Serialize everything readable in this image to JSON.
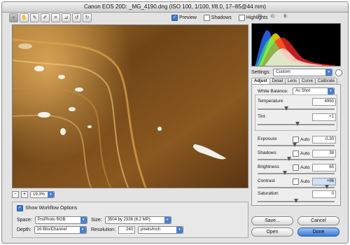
{
  "window": {
    "title": "Canon EOS 20D:  _MG_4190.dng  (ISO 100, 1/100, f/8.0, 17–85@44 mm)"
  },
  "toolbar": {
    "tools": [
      "zoom-tool-icon",
      "hand-tool-icon",
      "white-balance-tool-icon",
      "color-sampler-icon",
      "crop-tool-icon",
      "straighten-tool-icon",
      "rotate-left-icon",
      "rotate-right-icon"
    ]
  },
  "view_options": {
    "preview": {
      "label": "Preview",
      "checked": true
    },
    "shadows": {
      "label": "Shadows",
      "checked": false
    },
    "highlights": {
      "label": "Highlights",
      "checked": false
    }
  },
  "rgb_readout": {
    "r": "R:",
    "g": "G:",
    "b": "B:"
  },
  "zoom": {
    "minus": "-",
    "plus": "+",
    "value": "19.3%"
  },
  "workflow": {
    "show_label": "Show Workflow Options",
    "show_checked": true,
    "space_label": "Space:",
    "space_value": "ProPhoto RGB",
    "size_label": "Size:",
    "size_value": "3504 by 2336  (8.2 MP)",
    "depth_label": "Depth:",
    "depth_value": "16 Bits/Channel",
    "resolution_label": "Resolution:",
    "resolution_value": "240",
    "resolution_unit": "pixels/inch"
  },
  "settings": {
    "label": "Settings:",
    "value": "Custom"
  },
  "tabs": [
    "Adjust",
    "Detail",
    "Lens",
    "Curve",
    "Calibrate"
  ],
  "adjust": {
    "white_balance_label": "White Balance:",
    "white_balance_value": "As Shot",
    "temperature_label": "Temperature",
    "temperature_value": "4950",
    "tint_label": "Tint",
    "tint_value": "+1",
    "exposure_label": "Exposure",
    "exposure_value": "-0.30",
    "shadows_label": "Shadows",
    "shadows_value": "38",
    "brightness_label": "Brightness",
    "brightness_value": "65",
    "contrast_label": "Contrast",
    "contrast_value": "+96",
    "saturation_label": "Saturation",
    "saturation_value": "0",
    "auto_label": "Auto"
  },
  "buttons": {
    "save": "Save...",
    "cancel": "Cancel",
    "open": "Open",
    "done": "Done"
  },
  "colors": {
    "accent": "#3b78d6",
    "sand": "#704515"
  }
}
